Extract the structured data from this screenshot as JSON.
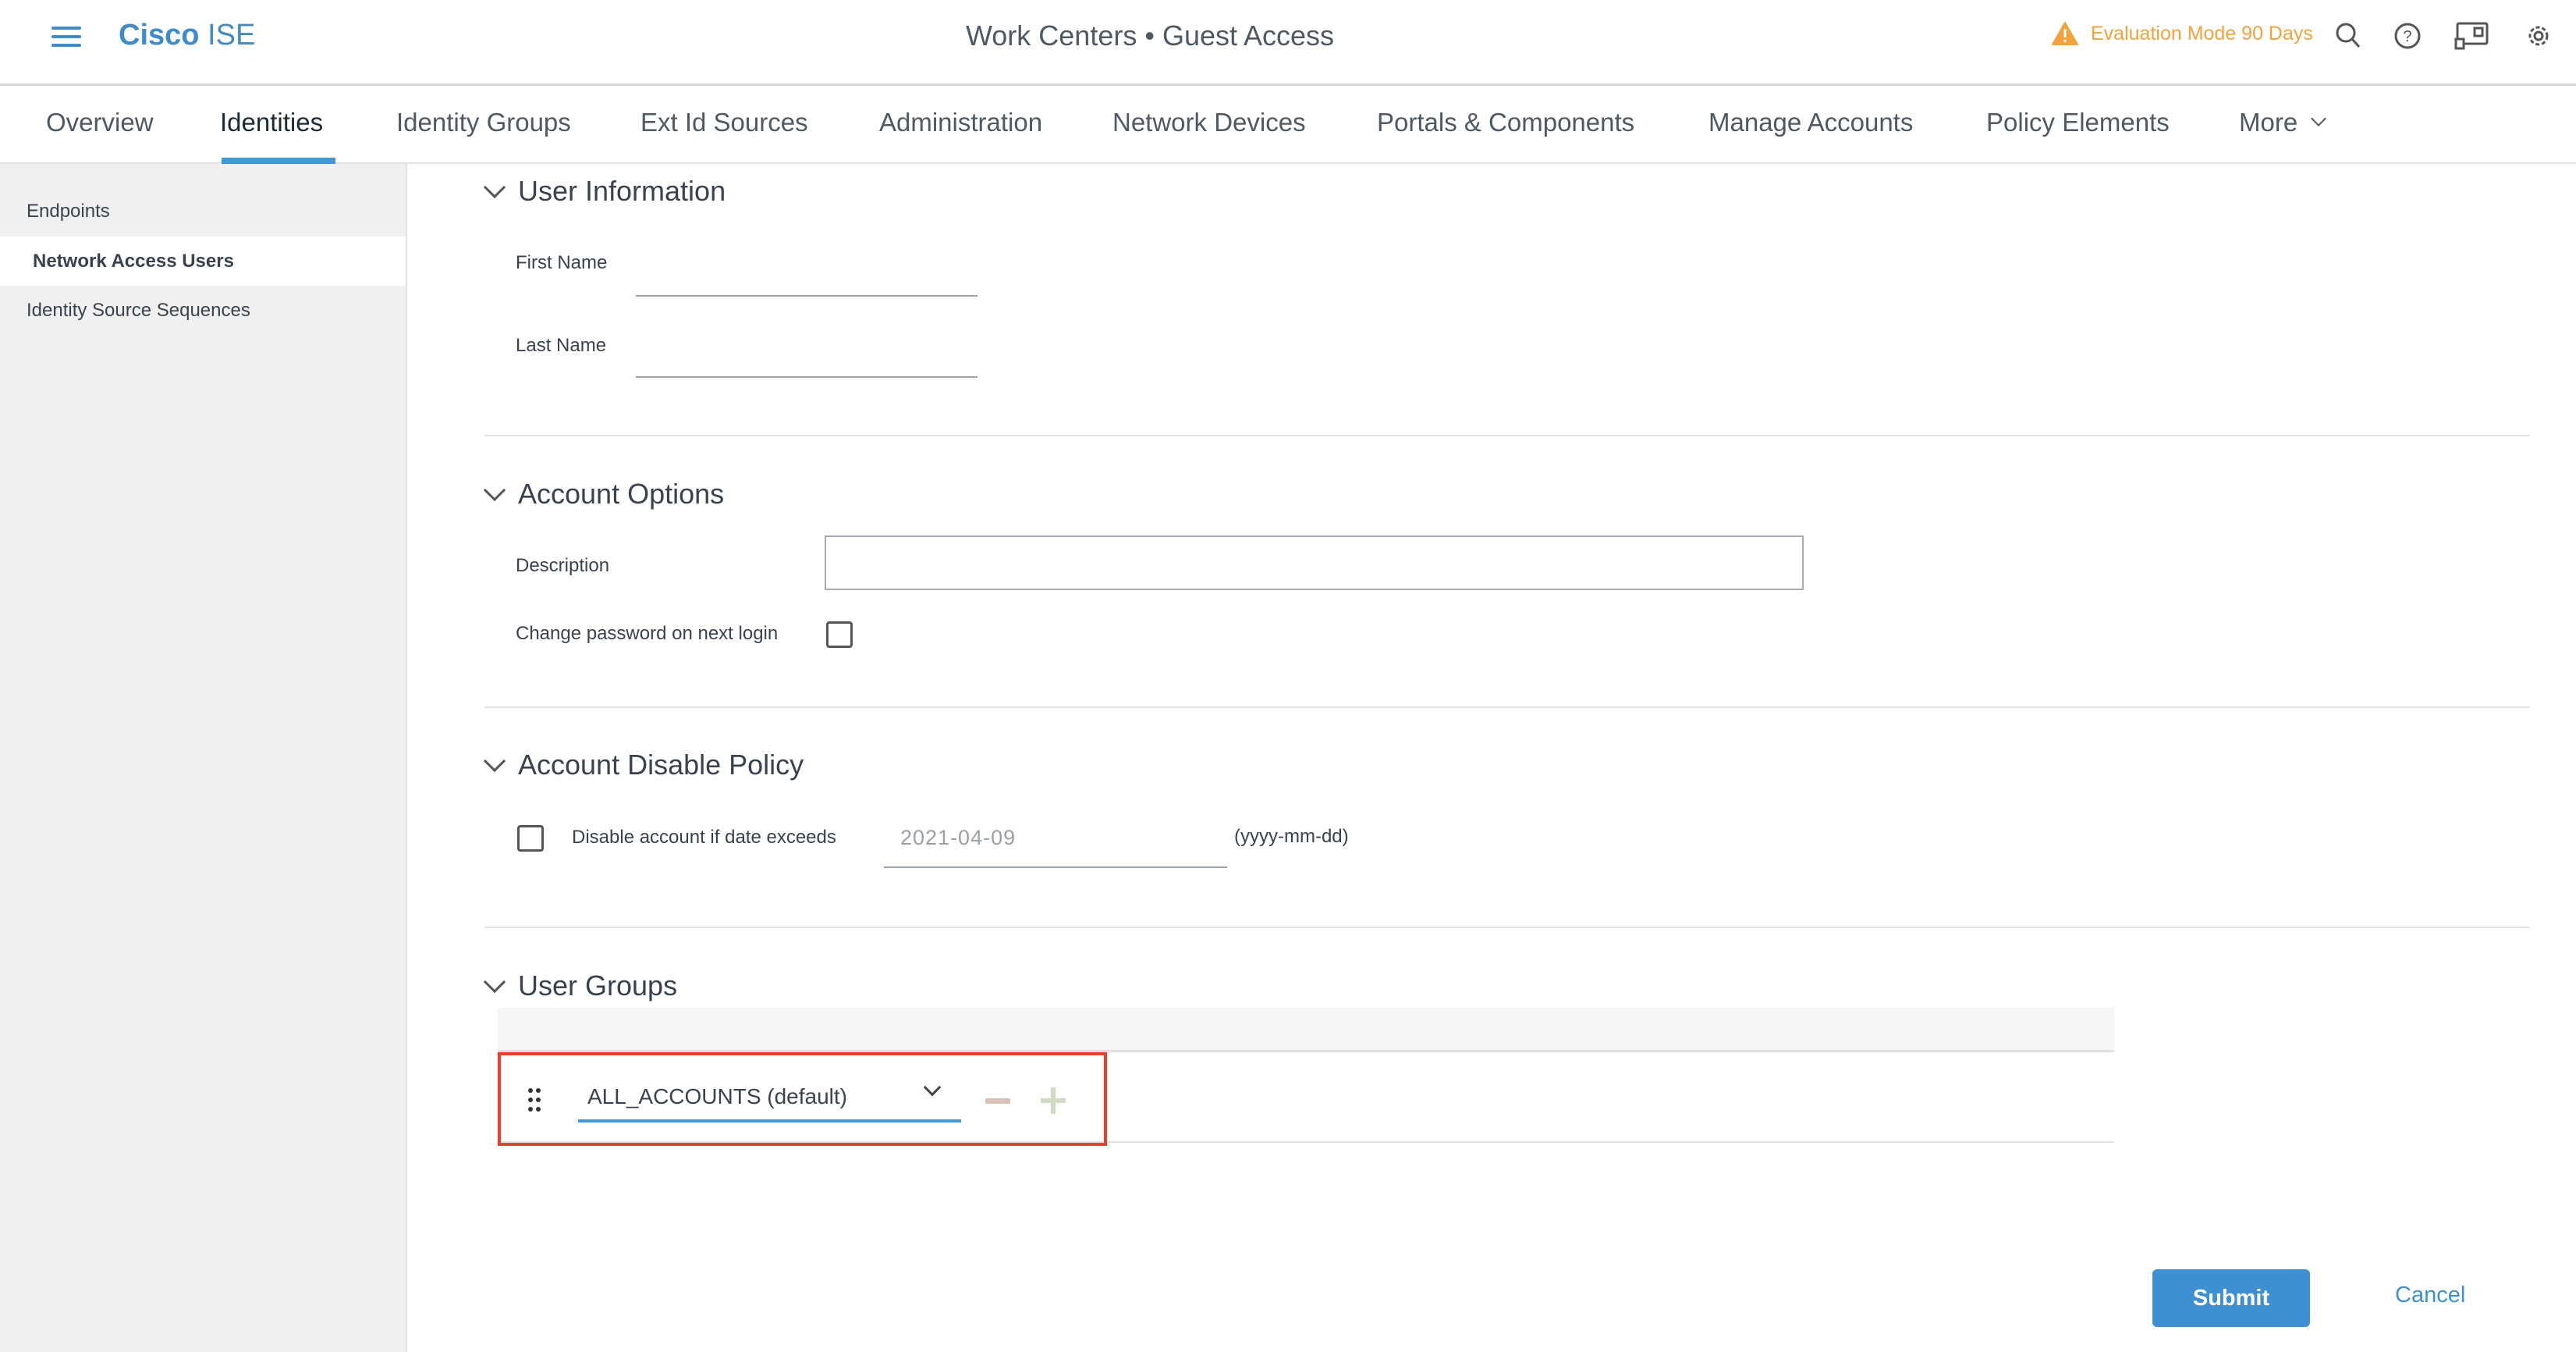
{
  "header": {
    "brand_bold": "Cisco",
    "brand_light": "ISE",
    "title": "Work Centers • Guest Access",
    "evaluation": "Evaluation Mode 90 Days",
    "icons": [
      "menu-icon",
      "warning-icon",
      "search-icon",
      "help-icon",
      "workflow-icon",
      "gear-icon"
    ],
    "accent": "#3f8ac9",
    "warning_color": "#f3a23c"
  },
  "tabs": [
    {
      "label": "Overview"
    },
    {
      "label": "Identities",
      "active": true
    },
    {
      "label": "Identity Groups"
    },
    {
      "label": "Ext Id Sources"
    },
    {
      "label": "Administration"
    },
    {
      "label": "Network Devices"
    },
    {
      "label": "Portals & Components"
    },
    {
      "label": "Manage Accounts"
    },
    {
      "label": "Policy Elements"
    },
    {
      "label": "More"
    }
  ],
  "sidebar": {
    "items": [
      {
        "label": "Endpoints"
      },
      {
        "label": "Network Access Users",
        "selected": true
      },
      {
        "label": "Identity Source Sequences"
      }
    ]
  },
  "user_info": {
    "heading": "User Information",
    "first_name_label": "First Name",
    "first_name": "",
    "last_name_label": "Last Name",
    "last_name": ""
  },
  "account_options": {
    "heading": "Account Options",
    "description_label": "Description",
    "description": "",
    "change_password_label": "Change password on next login",
    "change_password": false
  },
  "disable_policy": {
    "heading": "Account Disable Policy",
    "checkbox_label": "Disable account if date exceeds",
    "checked": false,
    "date_placeholder": "2021-04-09",
    "format_hint": "(yyyy-mm-dd)"
  },
  "user_groups": {
    "heading": "User Groups",
    "selected": "ALL_ACCOUNTS (default)",
    "highlight_color": "#e8402a"
  },
  "actions": {
    "submit": "Submit",
    "cancel": "Cancel"
  }
}
